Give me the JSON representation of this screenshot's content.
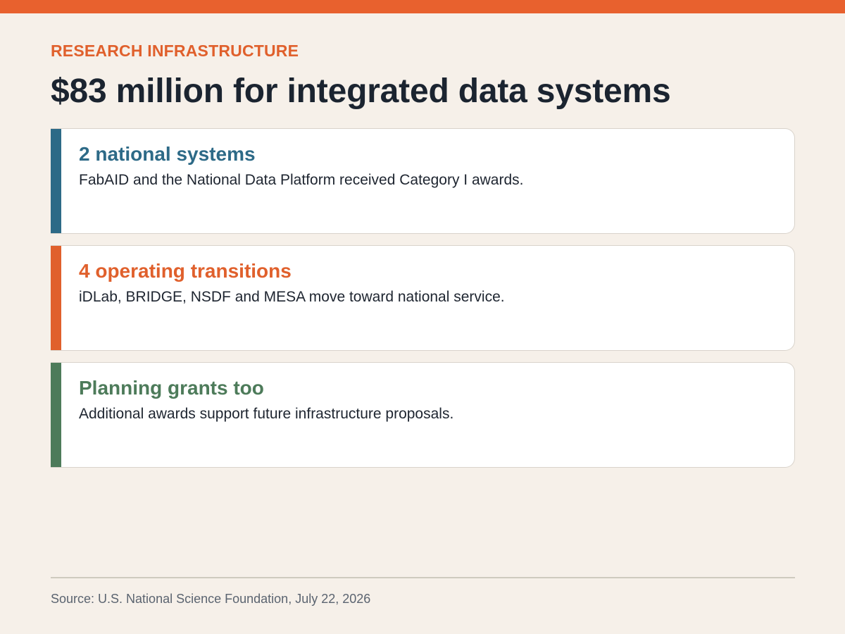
{
  "header": {
    "eyebrow": "RESEARCH INFRASTRUCTURE",
    "title": "$83 million for integrated data systems"
  },
  "cards": [
    {
      "title": "2 national systems",
      "body": "FabAID and the National Data Platform received Category I awards.",
      "color": "#2d6a87"
    },
    {
      "title": "4 operating transitions",
      "body": "iDLab, BRIDGE, NSDF and MESA move toward national service.",
      "color": "#e0602c"
    },
    {
      "title": "Planning grants too",
      "body": "Additional awards support future infrastructure proposals.",
      "color": "#4d7b5a"
    }
  ],
  "footer": {
    "source": "Source: U.S. National Science Foundation, July 22, 2026"
  },
  "colors": {
    "accent_orange": "#e8612e",
    "background": "#f6f0e9",
    "headline": "#1b2430"
  }
}
